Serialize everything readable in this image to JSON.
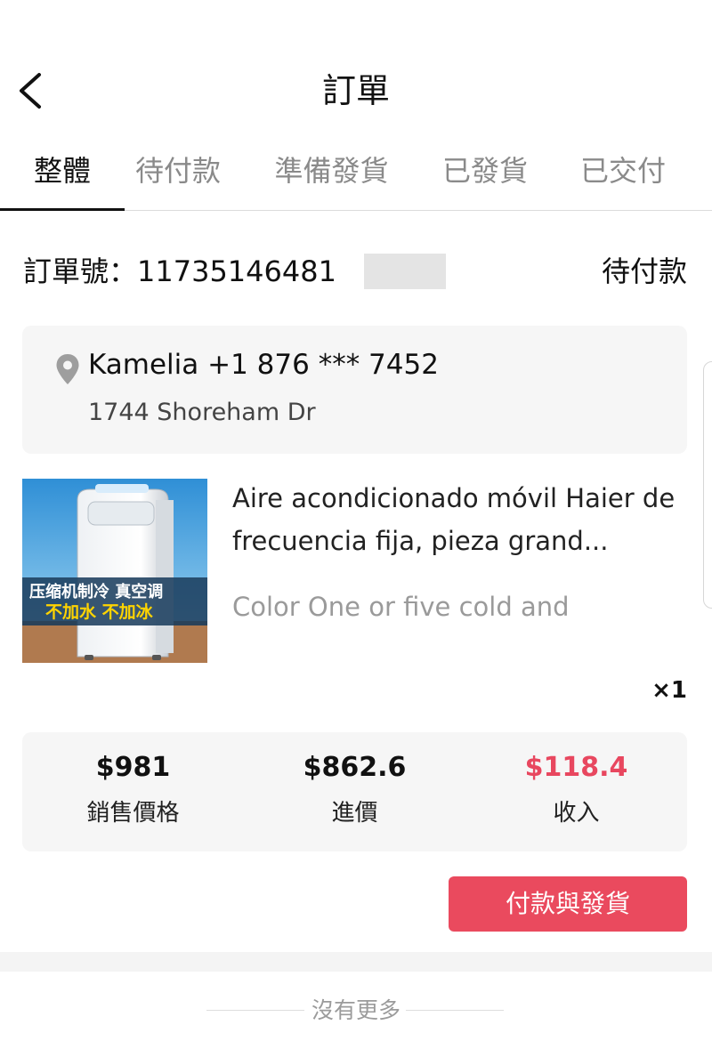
{
  "header": {
    "title": "訂單"
  },
  "tabs": [
    {
      "label": "整體"
    },
    {
      "label": "待付款"
    },
    {
      "label": "準備發貨"
    },
    {
      "label": "已發貨"
    },
    {
      "label": "已交付"
    }
  ],
  "order": {
    "label": "訂單號：11735146481",
    "status": "待付款"
  },
  "address": {
    "name_phone": "Kamelia +1 876 *** 7452",
    "street": "1744 Shoreham Dr"
  },
  "product": {
    "title": "Aire acondicionado móvil Haier de frecuencia fija, pieza grand...",
    "variant": "Color One or five cold and",
    "quantity": "×1",
    "image_text_line1": "压缩机制冷 真空调",
    "image_text_line2": "不加水 不加冰"
  },
  "prices": [
    {
      "value": "$981",
      "label": "銷售價格"
    },
    {
      "value": "$862.6",
      "label": "進價"
    },
    {
      "value": "$118.4",
      "label": "收入"
    }
  ],
  "actions": {
    "pay_label": "付款與發貨"
  },
  "footer": {
    "no_more": "沒有更多"
  },
  "colors": {
    "accent": "#ea4a5e",
    "income": "#e8475f",
    "card_bg": "#f6f6f6"
  }
}
